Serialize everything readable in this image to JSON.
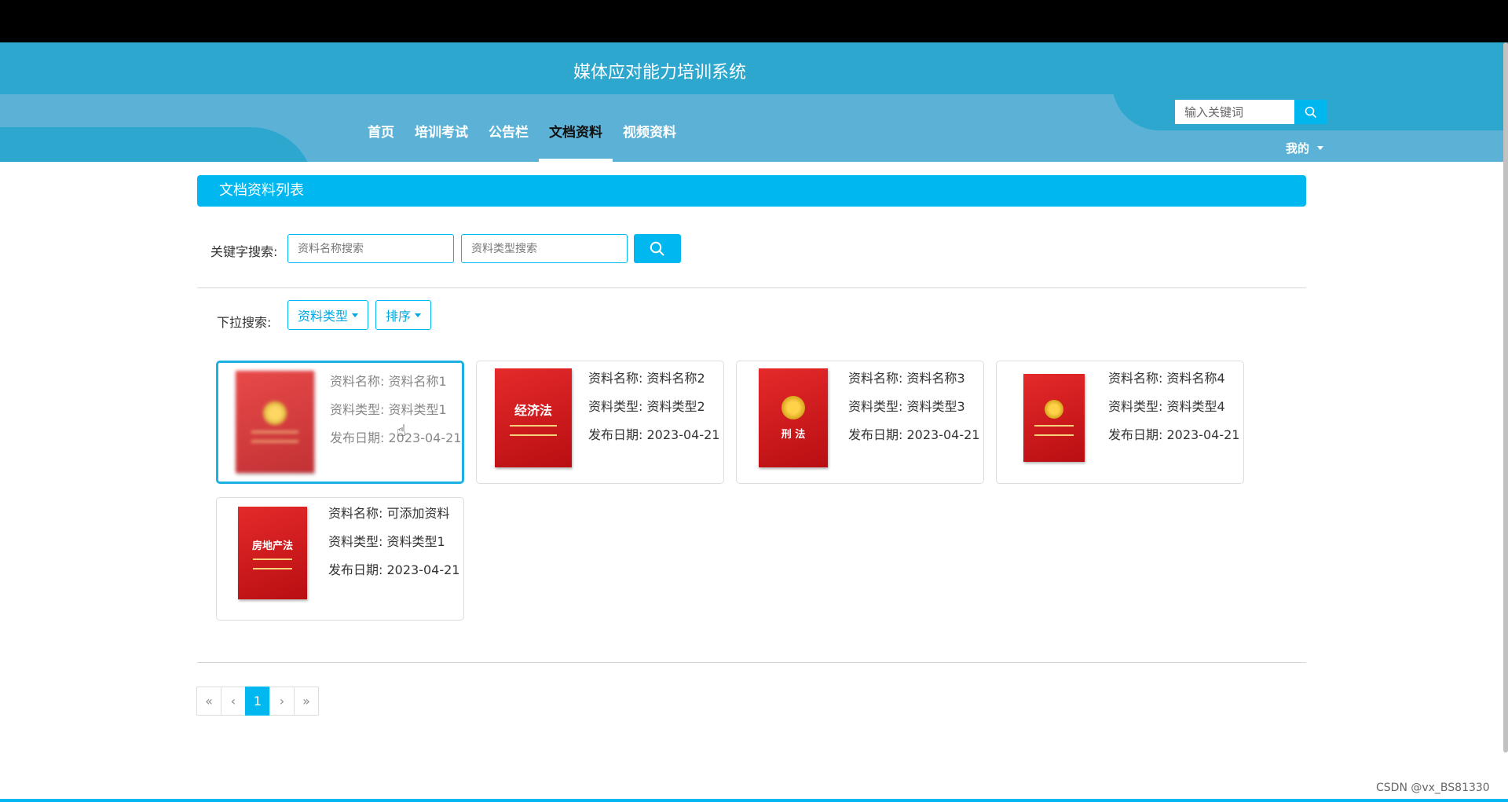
{
  "site": {
    "title": "媒体应对能力培训系统"
  },
  "nav": {
    "items": [
      {
        "label": "首页"
      },
      {
        "label": "培训考试"
      },
      {
        "label": "公告栏"
      },
      {
        "label": "文档资料"
      },
      {
        "label": "视频资料"
      }
    ],
    "active": "文档资料"
  },
  "header_search": {
    "placeholder": "输入关键词"
  },
  "user_menu": {
    "label": "我的"
  },
  "section": {
    "title": "文档资料列表"
  },
  "keyword_search": {
    "label": "关键字搜索:",
    "name_placeholder": "资料名称搜索",
    "type_placeholder": "资料类型搜索"
  },
  "dropdown_search": {
    "label": "下拉搜索:",
    "type_button": "资料类型",
    "sort_button": "排序"
  },
  "cards": [
    {
      "name": "资料名称: 资料名称1",
      "type": "资料类型: 资料类型1",
      "date": "发布日期: 2023-04-21",
      "cover_title": ""
    },
    {
      "name": "资料名称: 资料名称2",
      "type": "资料类型: 资料类型2",
      "date": "发布日期: 2023-04-21",
      "cover_title": "经济法"
    },
    {
      "name": "资料名称: 资料名称3",
      "type": "资料类型: 资料类型3",
      "date": "发布日期: 2023-04-21",
      "cover_title": "刑 法"
    },
    {
      "name": "资料名称: 资料名称4",
      "type": "资料类型: 资料类型4",
      "date": "发布日期: 2023-04-21",
      "cover_title": ""
    },
    {
      "name": "资料名称: 可添加资料",
      "type": "资料类型: 资料类型1",
      "date": "发布日期: 2023-04-21",
      "cover_title": "房地产法"
    }
  ],
  "pagination": {
    "first": "«",
    "prev": "‹",
    "current": "1",
    "next": "›",
    "last": "»"
  },
  "watermark": "CSDN @vx_BS81330"
}
